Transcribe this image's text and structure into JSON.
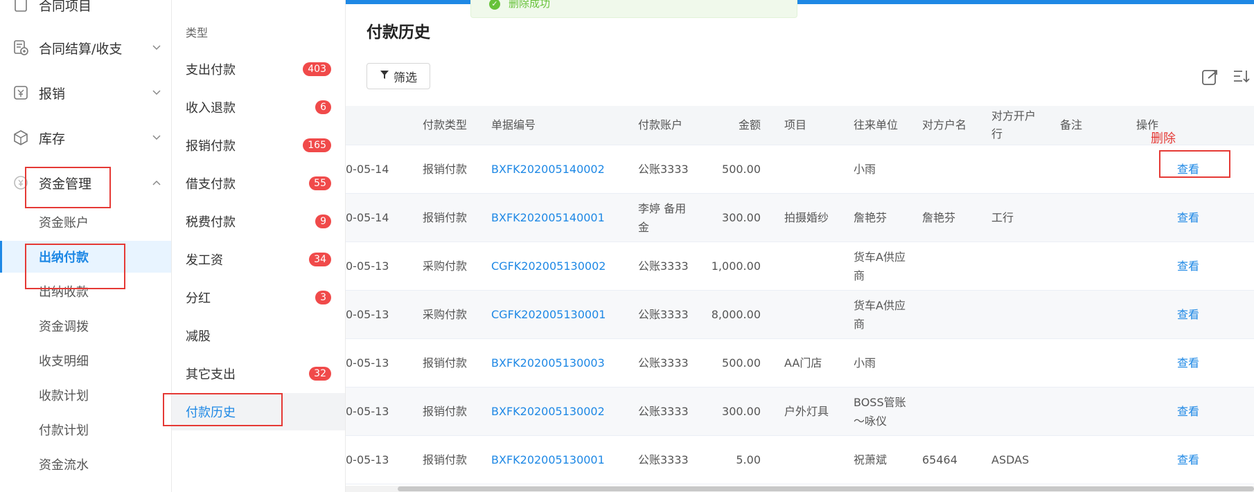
{
  "toast": {
    "message": "删除成功"
  },
  "sidebar": {
    "menus": [
      {
        "label": "合同项目",
        "icon": "document-icon"
      },
      {
        "label": "合同结算/收支",
        "icon": "contract-settlement-icon"
      },
      {
        "label": "报销",
        "icon": "reimburse-icon"
      },
      {
        "label": "库存",
        "icon": "box-icon"
      },
      {
        "label": "资金管理",
        "icon": "money-icon"
      }
    ],
    "subs": [
      {
        "label": "资金账户"
      },
      {
        "label": "出纳付款"
      },
      {
        "label": "出纳收款"
      },
      {
        "label": "资金调拨"
      },
      {
        "label": "收支明细"
      },
      {
        "label": "收款计划"
      },
      {
        "label": "付款计划"
      },
      {
        "label": "资金流水"
      }
    ]
  },
  "types": {
    "header": "类型",
    "items": [
      {
        "label": "支出付款",
        "badge": "403"
      },
      {
        "label": "收入退款",
        "badge": "6"
      },
      {
        "label": "报销付款",
        "badge": "165"
      },
      {
        "label": "借支付款",
        "badge": "55"
      },
      {
        "label": "税费付款",
        "badge": "9"
      },
      {
        "label": "发工资",
        "badge": "34"
      },
      {
        "label": "分红",
        "badge": "3"
      },
      {
        "label": "减股",
        "badge": ""
      },
      {
        "label": "其它支出",
        "badge": "32"
      },
      {
        "label": "付款历史",
        "badge": ""
      }
    ]
  },
  "main": {
    "title": "付款历史",
    "filter_label": "筛选",
    "delete_label": "删除",
    "columns": [
      "",
      "付款类型",
      "单据编号",
      "付款账户",
      "金额",
      "项目",
      "往来单位",
      "对方户名",
      "对方开户行",
      "备注",
      "操作"
    ],
    "rows": [
      {
        "date": "0-05-14",
        "type": "报销付款",
        "no": "BXFK202005140002",
        "account": "公账3333",
        "amount": "500.00",
        "project": "",
        "unit": "小雨",
        "name": "",
        "bank": "",
        "note": "",
        "action": "查看"
      },
      {
        "date": "0-05-14",
        "type": "报销付款",
        "no": "BXFK202005140001",
        "account": "李婷 备用金",
        "amount": "300.00",
        "project": "拍摄婚纱",
        "unit": "詹艳芬",
        "name": "詹艳芬",
        "bank": "工行",
        "note": "",
        "action": "查看"
      },
      {
        "date": "0-05-13",
        "type": "采购付款",
        "no": "CGFK202005130002",
        "account": "公账3333",
        "amount": "1,000.00",
        "project": "",
        "unit": "货车A供应商",
        "name": "",
        "bank": "",
        "note": "",
        "action": "查看"
      },
      {
        "date": "0-05-13",
        "type": "采购付款",
        "no": "CGFK202005130001",
        "account": "公账3333",
        "amount": "8,000.00",
        "project": "",
        "unit": "货车A供应商",
        "name": "",
        "bank": "",
        "note": "",
        "action": "查看"
      },
      {
        "date": "0-05-13",
        "type": "报销付款",
        "no": "BXFK202005130003",
        "account": "公账3333",
        "amount": "500.00",
        "project": "AA门店",
        "unit": "小雨",
        "name": "",
        "bank": "",
        "note": "",
        "action": "查看"
      },
      {
        "date": "0-05-13",
        "type": "报销付款",
        "no": "BXFK202005130002",
        "account": "公账3333",
        "amount": "300.00",
        "project": "户外灯具",
        "unit": "BOSS管账～咏仪",
        "name": "",
        "bank": "",
        "note": "",
        "action": "查看"
      },
      {
        "date": "0-05-13",
        "type": "报销付款",
        "no": "BXFK202005130001",
        "account": "公账3333",
        "amount": "5.00",
        "project": "",
        "unit": "祝萧斌",
        "name": "65464",
        "bank": "ASDAS",
        "note": "",
        "action": "查看"
      }
    ]
  }
}
